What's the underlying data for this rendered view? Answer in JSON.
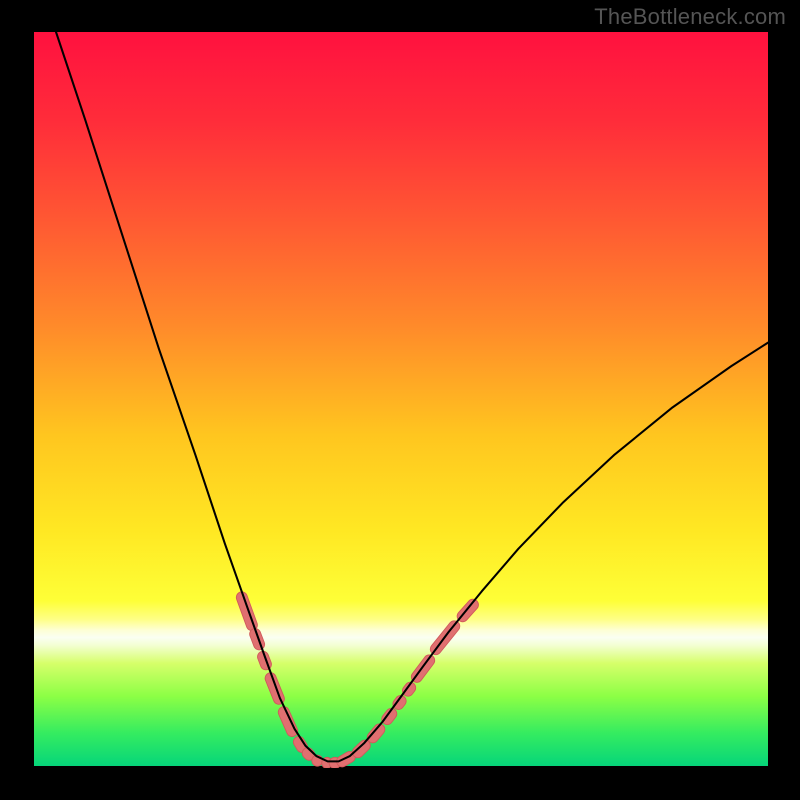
{
  "watermark": "TheBottleneck.com",
  "colors": {
    "frame": "#000000",
    "watermark_text": "#555555",
    "curve_stroke": "#000000",
    "marker_fill": "#e06f70",
    "marker_stroke": "#d05a5a",
    "gradient_stops": [
      {
        "offset": 0.0,
        "color": "#ff113f"
      },
      {
        "offset": 0.12,
        "color": "#ff2c3a"
      },
      {
        "offset": 0.25,
        "color": "#ff5633"
      },
      {
        "offset": 0.4,
        "color": "#ff8a2a"
      },
      {
        "offset": 0.55,
        "color": "#ffc61f"
      },
      {
        "offset": 0.68,
        "color": "#ffe823"
      },
      {
        "offset": 0.775,
        "color": "#feff37"
      },
      {
        "offset": 0.8,
        "color": "#feff85"
      },
      {
        "offset": 0.815,
        "color": "#fdffd5"
      },
      {
        "offset": 0.825,
        "color": "#fafff2"
      },
      {
        "offset": 0.835,
        "color": "#f4ffd5"
      },
      {
        "offset": 0.86,
        "color": "#d6ff6a"
      },
      {
        "offset": 0.905,
        "color": "#8cff45"
      },
      {
        "offset": 0.955,
        "color": "#35ec60"
      },
      {
        "offset": 1.0,
        "color": "#06d57a"
      }
    ]
  },
  "chart_data": {
    "type": "line",
    "title": "",
    "xlabel": "",
    "ylabel": "",
    "x_range": [
      0,
      100
    ],
    "y_range": [
      0,
      100
    ],
    "curve_points": [
      {
        "x": 3.0,
        "y": 100.0
      },
      {
        "x": 7.0,
        "y": 88.0
      },
      {
        "x": 12.0,
        "y": 72.5
      },
      {
        "x": 17.0,
        "y": 57.0
      },
      {
        "x": 22.0,
        "y": 42.5
      },
      {
        "x": 26.0,
        "y": 30.5
      },
      {
        "x": 29.0,
        "y": 22.0
      },
      {
        "x": 31.5,
        "y": 15.0
      },
      {
        "x": 33.5,
        "y": 9.5
      },
      {
        "x": 35.5,
        "y": 5.3
      },
      {
        "x": 37.0,
        "y": 3.0
      },
      {
        "x": 38.5,
        "y": 1.6
      },
      {
        "x": 40.0,
        "y": 0.9
      },
      {
        "x": 41.5,
        "y": 0.9
      },
      {
        "x": 43.0,
        "y": 1.6
      },
      {
        "x": 45.0,
        "y": 3.4
      },
      {
        "x": 47.5,
        "y": 6.3
      },
      {
        "x": 50.0,
        "y": 9.7
      },
      {
        "x": 53.0,
        "y": 13.8
      },
      {
        "x": 56.5,
        "y": 18.5
      },
      {
        "x": 61.0,
        "y": 24.0
      },
      {
        "x": 66.0,
        "y": 29.8
      },
      {
        "x": 72.0,
        "y": 36.0
      },
      {
        "x": 79.0,
        "y": 42.5
      },
      {
        "x": 87.0,
        "y": 49.0
      },
      {
        "x": 95.0,
        "y": 54.6
      },
      {
        "x": 100.0,
        "y": 57.8
      }
    ],
    "markers": [
      {
        "x": 29.0,
        "y": 21.3,
        "len": 5.5,
        "angle": -70
      },
      {
        "x": 30.4,
        "y": 17.5,
        "len": 3.0,
        "angle": -69
      },
      {
        "x": 31.4,
        "y": 14.6,
        "len": 2.6,
        "angle": -69
      },
      {
        "x": 32.8,
        "y": 10.8,
        "len": 4.5,
        "angle": -68
      },
      {
        "x": 34.6,
        "y": 6.3,
        "len": 4.3,
        "angle": -66
      },
      {
        "x": 36.3,
        "y": 3.2,
        "len": 2.3,
        "angle": -58
      },
      {
        "x": 37.4,
        "y": 1.9,
        "len": 1.8,
        "angle": -45
      },
      {
        "x": 38.6,
        "y": 1.0,
        "len": 1.5,
        "angle": -22
      },
      {
        "x": 39.9,
        "y": 0.7,
        "len": 1.4,
        "angle": -5
      },
      {
        "x": 41.0,
        "y": 0.7,
        "len": 1.6,
        "angle": 10
      },
      {
        "x": 42.5,
        "y": 1.2,
        "len": 2.7,
        "angle": 30
      },
      {
        "x": 44.6,
        "y": 2.6,
        "len": 2.8,
        "angle": 44
      },
      {
        "x": 46.6,
        "y": 4.7,
        "len": 2.9,
        "angle": 50
      },
      {
        "x": 48.4,
        "y": 7.0,
        "len": 2.4,
        "angle": 52
      },
      {
        "x": 49.8,
        "y": 8.9,
        "len": 2.0,
        "angle": 53
      },
      {
        "x": 51.1,
        "y": 10.7,
        "len": 2.0,
        "angle": 53
      },
      {
        "x": 53.0,
        "y": 13.5,
        "len": 4.3,
        "angle": 53
      },
      {
        "x": 56.0,
        "y": 17.7,
        "len": 5.5,
        "angle": 51
      },
      {
        "x": 59.1,
        "y": 21.4,
        "len": 3.6,
        "angle": 48
      }
    ]
  }
}
